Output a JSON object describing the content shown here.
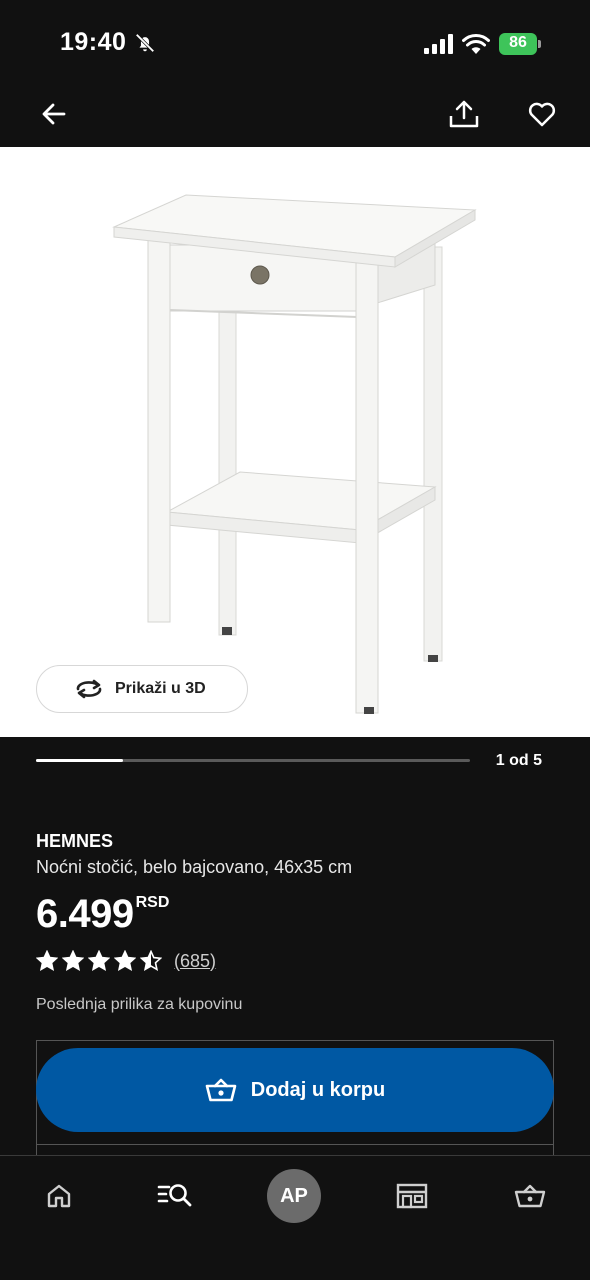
{
  "status_bar": {
    "time": "19:40",
    "battery_level": "86",
    "icons": [
      "bell-off-icon",
      "signal-icon",
      "wifi-icon",
      "battery-icon"
    ]
  },
  "app_bar": {
    "icons": [
      "back-arrow-icon",
      "share-icon",
      "heart-icon"
    ]
  },
  "gallery": {
    "view_3d_label": "Prikaži u 3D",
    "page_indicator": "1 od 5",
    "current_page": 1,
    "total_pages": 5,
    "progress_fraction": 0.2
  },
  "product": {
    "name": "HEMNES",
    "description": "Noćni stočić, belo bajcovano, 46x35 cm",
    "price": "6.499",
    "currency": "RSD",
    "rating": 4.5,
    "review_count": "(685)",
    "availability": "Poslednja prilika za kupovinu"
  },
  "cta": {
    "add_to_cart_label": "Dodaj u korpu",
    "color": "#0058a3"
  },
  "bottom_nav": {
    "profile_initials": "AP",
    "icons": [
      "home-icon",
      "search-list-icon",
      "avatar",
      "store-icon",
      "shopping-basket-icon"
    ]
  }
}
